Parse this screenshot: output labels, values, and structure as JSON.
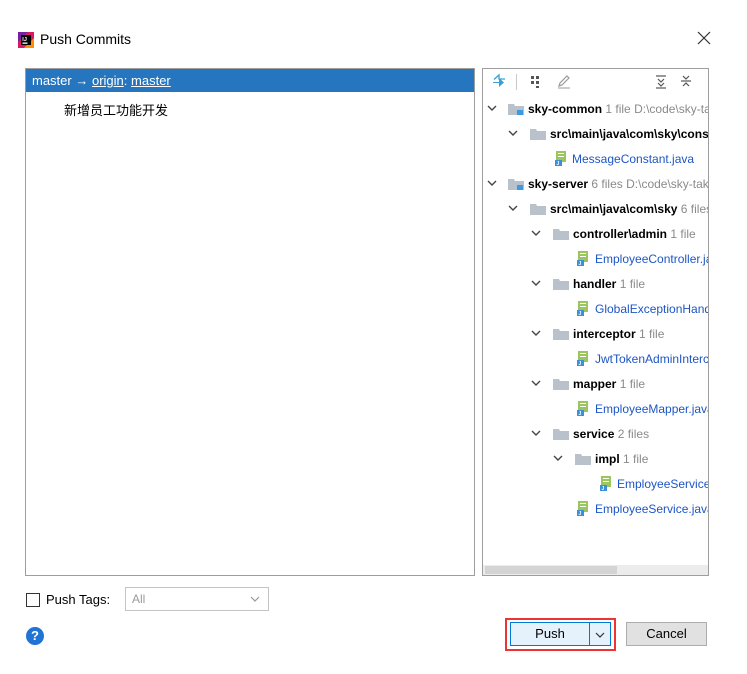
{
  "window": {
    "title": "Push Commits"
  },
  "branch": {
    "local": "master",
    "arrow": "→",
    "remote": "origin",
    "separator": ":",
    "remote_branch": "master"
  },
  "commits": [
    {
      "message": "新增员工功能开发"
    }
  ],
  "tree": [
    {
      "kind": "module",
      "name": "sky-common",
      "count": "1 file",
      "path": "D:\\code\\sky-take-out\\sky-common"
    },
    {
      "kind": "dir",
      "name": "src\\main\\java\\com\\sky\\constant",
      "count": ""
    },
    {
      "kind": "file",
      "name": "MessageConstant.java"
    },
    {
      "kind": "module",
      "name": "sky-server",
      "count": "6 files",
      "path": "D:\\code\\sky-take-out\\sky-server"
    },
    {
      "kind": "dir",
      "name": "src\\main\\java\\com\\sky",
      "count": "6 files"
    },
    {
      "kind": "dir",
      "name": "controller\\admin",
      "count": "1 file"
    },
    {
      "kind": "file",
      "name": "EmployeeController.java"
    },
    {
      "kind": "dir",
      "name": "handler",
      "count": "1 file"
    },
    {
      "kind": "file",
      "name": "GlobalExceptionHandler.java"
    },
    {
      "kind": "dir",
      "name": "interceptor",
      "count": "1 file"
    },
    {
      "kind": "file",
      "name": "JwtTokenAdminInterceptor.java"
    },
    {
      "kind": "dir",
      "name": "mapper",
      "count": "1 file"
    },
    {
      "kind": "file",
      "name": "EmployeeMapper.java"
    },
    {
      "kind": "dir",
      "name": "service",
      "count": "2 files"
    },
    {
      "kind": "dir",
      "name": "impl",
      "count": "1 file"
    },
    {
      "kind": "file",
      "name": "EmployeeServiceImpl.java"
    },
    {
      "kind": "file",
      "name": "EmployeeService.java"
    }
  ],
  "options": {
    "push_tags_label": "Push Tags:",
    "push_tags_value": "All"
  },
  "buttons": {
    "push": "Push",
    "cancel": "Cancel",
    "help": "?"
  },
  "colors": {
    "selection": "#2675bf",
    "file_link": "#1d56c4",
    "highlight_box": "#ee3333"
  }
}
